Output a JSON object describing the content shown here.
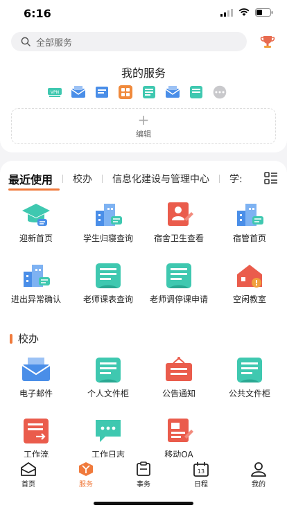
{
  "status_bar": {
    "time": "6:16"
  },
  "search": {
    "placeholder": "全部服务"
  },
  "my_services": {
    "title": "我的服务",
    "quick_icons": [
      "vpn-icon",
      "email-icon",
      "document-icon",
      "app-grid-icon",
      "file-cabinet-icon",
      "mail-send-icon",
      "file-folder-icon",
      "more-icon"
    ],
    "edit_label": "编辑"
  },
  "tabs": [
    "最近使用",
    "校办",
    "信息化建设与管理中心",
    "学:"
  ],
  "recent_apps": [
    {
      "label": "迎新首页",
      "icon": "graduation-cap-icon"
    },
    {
      "label": "学生归寝查询",
      "icon": "buildings-icon"
    },
    {
      "label": "宿舍卫生查看",
      "icon": "badge-check-icon"
    },
    {
      "label": "宿管首页",
      "icon": "buildings-icon"
    },
    {
      "label": "进出异常确认",
      "icon": "buildings-icon"
    },
    {
      "label": "老师课表查询",
      "icon": "file-cabinet-icon"
    },
    {
      "label": "老师调停课申请",
      "icon": "file-cabinet-icon"
    },
    {
      "label": "空闲教室",
      "icon": "house-alert-icon"
    }
  ],
  "section": {
    "title": "校办"
  },
  "office_apps": [
    {
      "label": "电子邮件",
      "icon": "email-icon"
    },
    {
      "label": "个人文件柜",
      "icon": "file-cabinet-icon"
    },
    {
      "label": "公告通知",
      "icon": "notice-board-icon"
    },
    {
      "label": "公共文件柜",
      "icon": "file-cabinet-icon"
    },
    {
      "label": "工作流",
      "icon": "workflow-icon"
    },
    {
      "label": "工作日志",
      "icon": "chat-bubble-icon"
    },
    {
      "label": "移动OA",
      "icon": "mobile-oa-icon"
    }
  ],
  "bottom_nav": [
    {
      "label": "首页",
      "icon": "home-icon"
    },
    {
      "label": "服务",
      "icon": "service-cube-icon"
    },
    {
      "label": "事务",
      "icon": "clipboard-icon"
    },
    {
      "label": "日程",
      "icon": "calendar-icon"
    },
    {
      "label": "我的",
      "icon": "user-icon"
    }
  ],
  "colors": {
    "accent": "#f07a3c",
    "teal": "#3fc8b0",
    "blue": "#4a8ee8",
    "red": "#ea5c4c"
  }
}
